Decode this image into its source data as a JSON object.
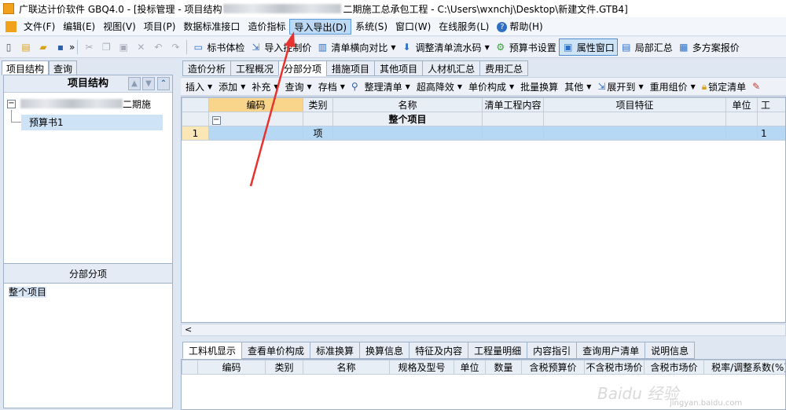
{
  "title": {
    "prefix": "广联达计价软件 GBQ4.0 - [投标管理 - 项目结构",
    "suffix": "二期施工总承包工程 - C:\\Users\\wxnchj\\Desktop\\新建文件.GTB4]"
  },
  "menu": [
    "文件(F)",
    "编辑(E)",
    "视图(V)",
    "项目(P)",
    "数据标准接口",
    "造价指标",
    "导入导出(D)",
    "系统(S)",
    "窗口(W)",
    "在线服务(L)",
    "帮助(H)"
  ],
  "menu_active": "导入导出(D)",
  "toolbar": {
    "overflow": "»",
    "biaoshu_check": "标书体检",
    "import_control_price": "导入控制价",
    "list_compare": "清单横向对比",
    "adjust_serial": "调整清单流水码",
    "budget_settings": "预算书设置",
    "property_window": "属性窗口",
    "local_summary": "局部汇总",
    "multi_report": "多方案报价"
  },
  "left_tabs": [
    "项目结构",
    "查询"
  ],
  "left_header": "项目结构",
  "tree": {
    "root_suffix": "二期施",
    "child": "预算书1"
  },
  "left_bottom": {
    "header": "分部分项",
    "item": "整个项目"
  },
  "main_tabs": [
    "造价分析",
    "工程概况",
    "分部分项",
    "措施项目",
    "其他项目",
    "人材机汇总",
    "费用汇总"
  ],
  "main_tab_active": "分部分项",
  "toolbar2": [
    "插入",
    "添加",
    "补充",
    "查询",
    "存档",
    "整理清单",
    "超高降效",
    "单价构成",
    "批量换算",
    "其他",
    "展开到",
    "重用组价",
    "锁定清单"
  ],
  "grid": {
    "headers": [
      "编码",
      "类别",
      "名称",
      "清单工程内容",
      "项目特征",
      "单位",
      "工"
    ],
    "group_row": {
      "toggle": "−",
      "name": "整个项目"
    },
    "rows": [
      {
        "no": "1",
        "code": "",
        "type": "项",
        "name": "",
        "content": "",
        "feature": "",
        "unit": "",
        "qty": "1"
      }
    ]
  },
  "hscroll": "<",
  "bottom_tabs": [
    "工料机显示",
    "查看单价构成",
    "标准换算",
    "换算信息",
    "特征及内容",
    "工程量明细",
    "内容指引",
    "查询用户清单",
    "说明信息"
  ],
  "bottom_tab_active": "工料机显示",
  "bottom_headers": [
    "编码",
    "类别",
    "名称",
    "规格及型号",
    "单位",
    "数量",
    "含税预算价",
    "不含税市场价",
    "含税市场价",
    "税率/调整系数(%)"
  ],
  "watermark": "Baidu 经验",
  "watermark_url": "jingyan.baidu.com",
  "colors": {
    "arrow": "#e8322e",
    "selection": "#b6d8f5",
    "header_selected": "#f8d58b"
  }
}
